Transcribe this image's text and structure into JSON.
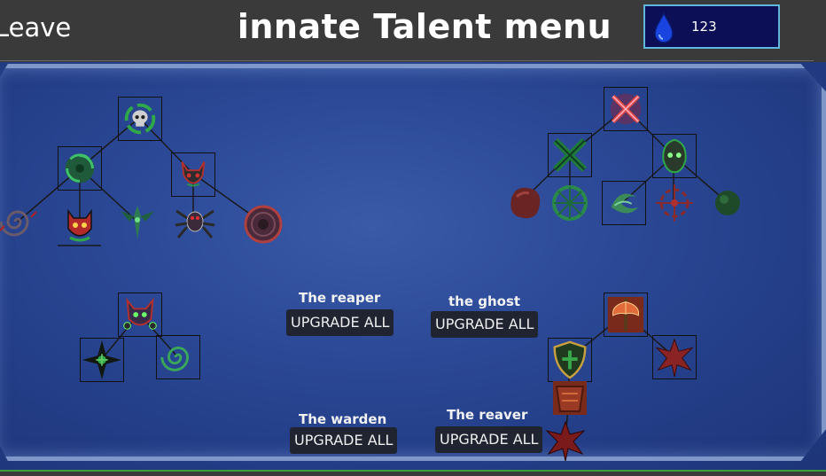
{
  "header": {
    "leave_label": "Leave",
    "title": "innate Talent menu",
    "currency_icon": "water-drop-icon",
    "currency_value": "123"
  },
  "colors": {
    "background": "#3a3a3a",
    "board": "#2c4a98",
    "currency_bg": "#0c0f55",
    "currency_border": "#5fb8d9",
    "button_bg": "#1f2430",
    "accent_green": "#3aa13a"
  },
  "groups": [
    {
      "name": "The reaper",
      "button": "UPGRADE ALL"
    },
    {
      "name": "the ghost",
      "button": "UPGRADE ALL"
    },
    {
      "name": "The warden",
      "button": "UPGRADE ALL"
    },
    {
      "name": "The reaver",
      "button": "UPGRADE ALL"
    }
  ]
}
